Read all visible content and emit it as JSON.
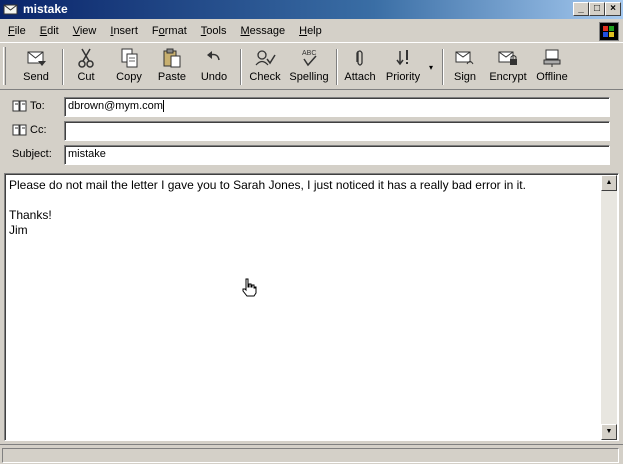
{
  "window": {
    "title": "mistake"
  },
  "menu": [
    {
      "label": "File",
      "accel": "F",
      "rest": "ile"
    },
    {
      "label": "Edit",
      "accel": "E",
      "rest": "dit"
    },
    {
      "label": "View",
      "accel": "V",
      "rest": "iew"
    },
    {
      "label": "Insert",
      "accel": "I",
      "rest": "nsert"
    },
    {
      "label": "Format",
      "accel": "o",
      "pre": "F",
      "rest": "rmat"
    },
    {
      "label": "Tools",
      "accel": "T",
      "rest": "ools"
    },
    {
      "label": "Message",
      "accel": "M",
      "rest": "essage"
    },
    {
      "label": "Help",
      "accel": "H",
      "rest": "elp"
    }
  ],
  "toolbar": {
    "send": "Send",
    "cut": "Cut",
    "copy": "Copy",
    "paste": "Paste",
    "undo": "Undo",
    "check": "Check",
    "spelling": "Spelling",
    "attach": "Attach",
    "priority": "Priority",
    "sign": "Sign",
    "encrypt": "Encrypt",
    "offline": "Offline"
  },
  "fields": {
    "to_label": "To:",
    "to_value": "dbrown@mym.com",
    "cc_label": "Cc:",
    "cc_value": "",
    "subject_label": "Subject:",
    "subject_value": "mistake"
  },
  "message": {
    "body": "Please do not mail the letter I gave you to Sarah Jones, I just noticed it has a really bad error in it.\n\nThanks!\nJim"
  },
  "icons": [
    "envelope-icon",
    "send-icon",
    "cut-icon",
    "copy-icon",
    "paste-icon",
    "undo-icon",
    "check-icon",
    "spelling-icon",
    "attach-icon",
    "priority-icon",
    "sign-icon",
    "encrypt-icon",
    "offline-icon",
    "address-book-icon",
    "hand-cursor-icon",
    "windows-logo-icon"
  ]
}
